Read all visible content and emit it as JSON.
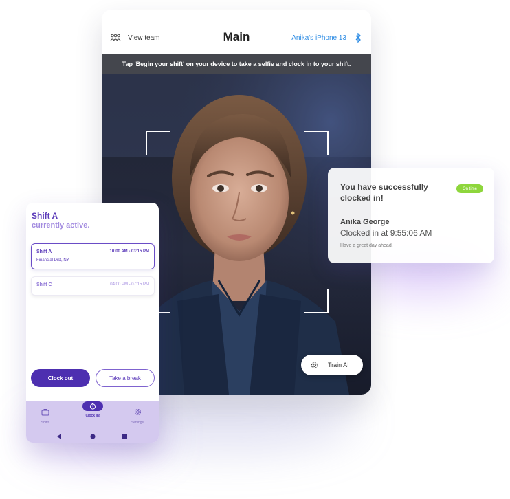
{
  "tablet": {
    "header": {
      "team_icon": "team-icon",
      "view_team": "View team",
      "title": "Main",
      "device": "Anika's iPhone 13",
      "bluetooth_icon": "bluetooth-icon"
    },
    "banner": "Tap 'Begin your shift' on your device to take a selfie and clock in to your shift.",
    "train_button": {
      "icon": "gear-icon",
      "label": "Train AI"
    }
  },
  "success_card": {
    "headline": "You have successfully clocked in!",
    "badge": "On time",
    "badge_color": "#8ed63c",
    "name": "Anika George",
    "clocked_text": "Clocked in at 9:55:06 AM",
    "message": "Have a great day ahead."
  },
  "phone": {
    "title": "Shift A",
    "subtitle": "currently active.",
    "shifts": [
      {
        "name": "Shift A",
        "time": "10:00 AM - 03:15 PM",
        "location": "Financial Dist, NY",
        "active": true
      },
      {
        "name": "Shift C",
        "time": "04:00 PM - 07:15 PM",
        "location": "",
        "active": false
      }
    ],
    "clock_out": "Clock out",
    "take_break": "Take a break",
    "nav": [
      {
        "icon": "briefcase-icon",
        "label": "Shifts"
      },
      {
        "icon": "stopwatch-icon",
        "label": "Clock in!"
      },
      {
        "icon": "gear-icon",
        "label": "Settings"
      }
    ],
    "system_nav": [
      "back-icon",
      "home-icon",
      "recents-icon"
    ]
  },
  "colors": {
    "primary": "#4d2fb0",
    "accent_blue": "#2f8de4",
    "nav_bg": "#d4c9ef"
  }
}
